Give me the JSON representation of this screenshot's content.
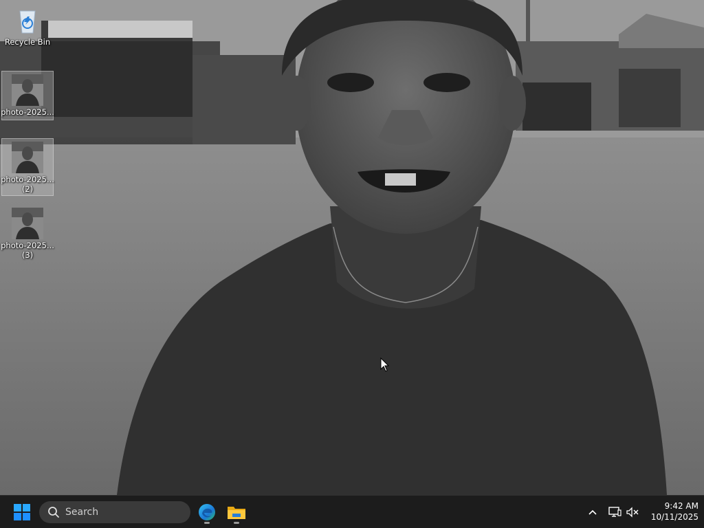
{
  "desktop": {
    "icons": [
      {
        "label": "Recycle Bin",
        "label2": "",
        "icon": "recycle-bin-icon"
      },
      {
        "label": "photo-2025...",
        "label2": "",
        "icon": "photo-thumbnail-icon"
      },
      {
        "label": "photo-2025...",
        "label2": "(2)",
        "icon": "photo-thumbnail-icon"
      },
      {
        "label": "photo-2025...",
        "label2": "(3)",
        "icon": "photo-thumbnail-icon"
      }
    ]
  },
  "taskbar": {
    "search_label": "Search",
    "apps": [
      {
        "name": "Microsoft Edge",
        "icon": "edge-icon"
      },
      {
        "name": "File Explorer",
        "icon": "folder-icon"
      }
    ],
    "clock": {
      "time": "9:42 AM",
      "date": "10/11/2025"
    }
  },
  "colors": {
    "taskbar_bg": "#1c1c1c",
    "search_bg": "#3a3a3a",
    "start_blue": "#1e90ff"
  }
}
